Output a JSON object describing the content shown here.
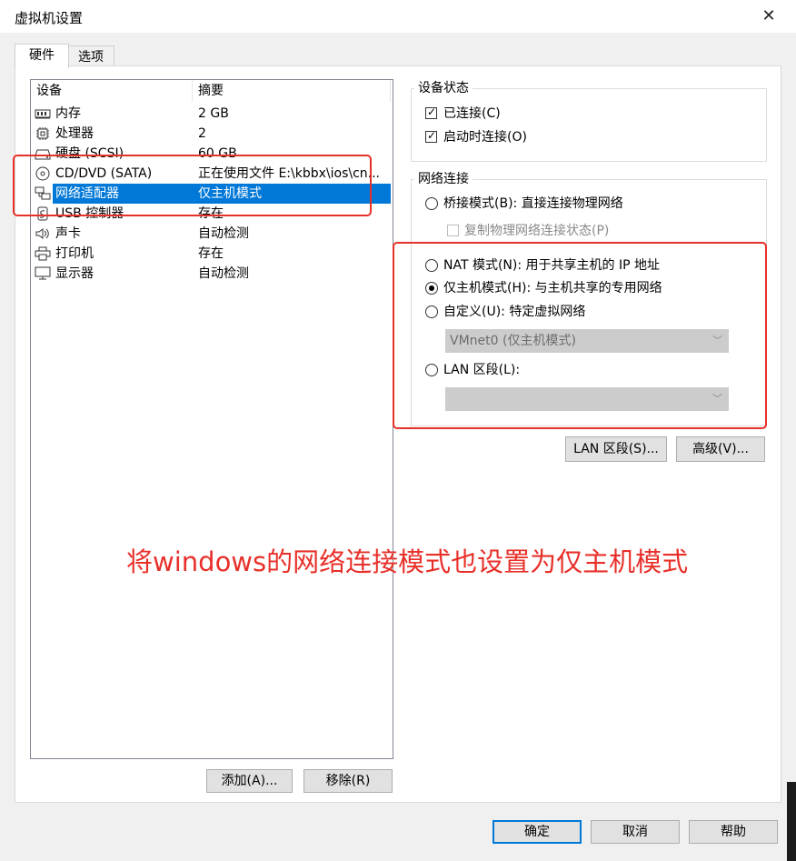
{
  "window": {
    "title": "虚拟机设置",
    "close_label": "✕"
  },
  "tabs": [
    {
      "label": "硬件"
    },
    {
      "label": "选项"
    }
  ],
  "device_list": {
    "headers": {
      "device": "设备",
      "summary": "摘要"
    },
    "rows": [
      {
        "name": "内存",
        "summary": "2 GB",
        "icon": "memory-icon"
      },
      {
        "name": "处理器",
        "summary": "2",
        "icon": "cpu-icon"
      },
      {
        "name": "硬盘 (SCSI)",
        "summary": "60 GB",
        "icon": "harddisk-icon"
      },
      {
        "name": "CD/DVD (SATA)",
        "summary": "正在使用文件 E:\\kbbx\\ios\\cn...",
        "icon": "cd-icon"
      },
      {
        "name": "网络适配器",
        "summary": "仅主机模式",
        "icon": "network-icon",
        "selected": true
      },
      {
        "name": "USB 控制器",
        "summary": "存在",
        "icon": "usb-icon"
      },
      {
        "name": "声卡",
        "summary": "自动检测",
        "icon": "speaker-icon"
      },
      {
        "name": "打印机",
        "summary": "存在",
        "icon": "printer-icon"
      },
      {
        "name": "显示器",
        "summary": "自动检测",
        "icon": "monitor-icon"
      }
    ],
    "add_button": "添加(A)...",
    "remove_button": "移除(R)"
  },
  "device_status": {
    "title": "设备状态",
    "connected": {
      "label": "已连接(C)",
      "checked": true
    },
    "connect_on_power_on": {
      "label": "启动时连接(O)",
      "checked": true
    }
  },
  "network_connection": {
    "title": "网络连接",
    "bridged": {
      "label": "桥接模式(B): 直接连接物理网络",
      "selected": false
    },
    "replicate": {
      "label": "复制物理网络连接状态(P)",
      "checked": false,
      "disabled": true
    },
    "nat": {
      "label": "NAT 模式(N): 用于共享主机的 IP 地址",
      "selected": false
    },
    "host_only": {
      "label": "仅主机模式(H): 与主机共享的专用网络",
      "selected": true
    },
    "custom": {
      "label": "自定义(U): 特定虚拟网络",
      "selected": false
    },
    "custom_select": {
      "value": "VMnet0 (仅主机模式)",
      "disabled": true
    },
    "lan_segment": {
      "label": "LAN 区段(L):",
      "selected": false
    },
    "lan_select": {
      "value": "",
      "disabled": true
    }
  },
  "buttons": {
    "lan_segments": "LAN 区段(S)...",
    "advanced": "高级(V)...",
    "ok": "确定",
    "cancel": "取消",
    "help": "帮助"
  },
  "annotation": {
    "text": "将windows的网络连接模式也设置为仅主机模式"
  },
  "colors": {
    "selection": "#0078d7",
    "annotation_red": "#e8302a",
    "default_button_border": "#0078d7"
  }
}
